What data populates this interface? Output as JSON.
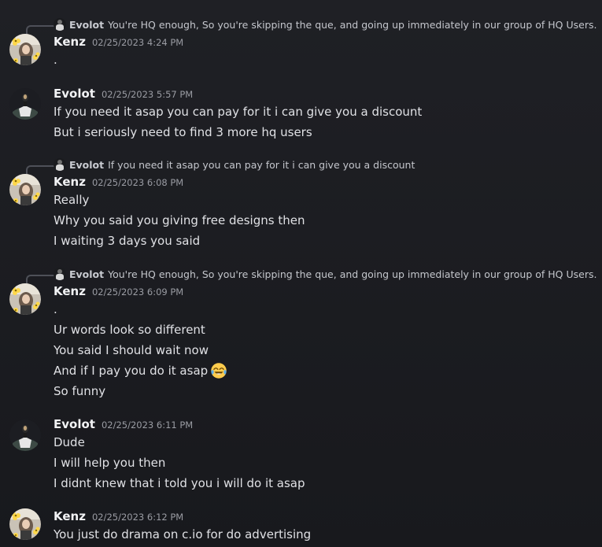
{
  "colors": {
    "background": "#1c1d22",
    "text": "#e0e1e5",
    "author": "#f2f3f5",
    "timestamp": "#9a9ca3",
    "reply_spine": "#4e5058"
  },
  "messages": [
    {
      "reply": {
        "author": "Evolot",
        "text": "You're HQ enough, So you're skipping the que, and going up immediately in our group of HQ Users."
      },
      "author": "Kenz",
      "timestamp": "02/25/2023 4:24 PM",
      "avatar_icon": "kenz-avatar",
      "lines": [
        "."
      ]
    },
    {
      "author": "Evolot",
      "timestamp": "02/25/2023 5:57 PM",
      "avatar_icon": "evolot-avatar",
      "lines": [
        "If you need it asap you can pay for it i can give you a discount",
        "But i seriously need to find 3 more hq users"
      ]
    },
    {
      "reply": {
        "author": "Evolot",
        "text": "If you need it asap you can pay for it i can give you a discount"
      },
      "author": "Kenz",
      "timestamp": "02/25/2023 6:08 PM",
      "avatar_icon": "kenz-avatar",
      "lines": [
        "Really",
        "Why you said you giving free designs then",
        "I waiting 3 days you said"
      ]
    },
    {
      "reply": {
        "author": "Evolot",
        "text": "You're HQ enough, So you're skipping the que, and going up immediately in our group of HQ Users."
      },
      "author": "Kenz",
      "timestamp": "02/25/2023 6:09 PM",
      "avatar_icon": "kenz-avatar",
      "lines": [
        ".",
        "Ur words look so different",
        "You said I should wait now",
        "And if I pay you do it asap",
        "So funny"
      ],
      "emoji_line_index": 3,
      "emoji_icon": "joy-emoji-icon"
    },
    {
      "author": "Evolot",
      "timestamp": "02/25/2023 6:11 PM",
      "avatar_icon": "evolot-avatar",
      "lines": [
        "Dude",
        "I will help you then",
        "I didnt knew that i told you i will do it asap"
      ]
    },
    {
      "author": "Kenz",
      "timestamp": "02/25/2023 6:12 PM",
      "avatar_icon": "kenz-avatar",
      "lines": [
        "You just do drama on c.io for do advertising"
      ]
    }
  ]
}
